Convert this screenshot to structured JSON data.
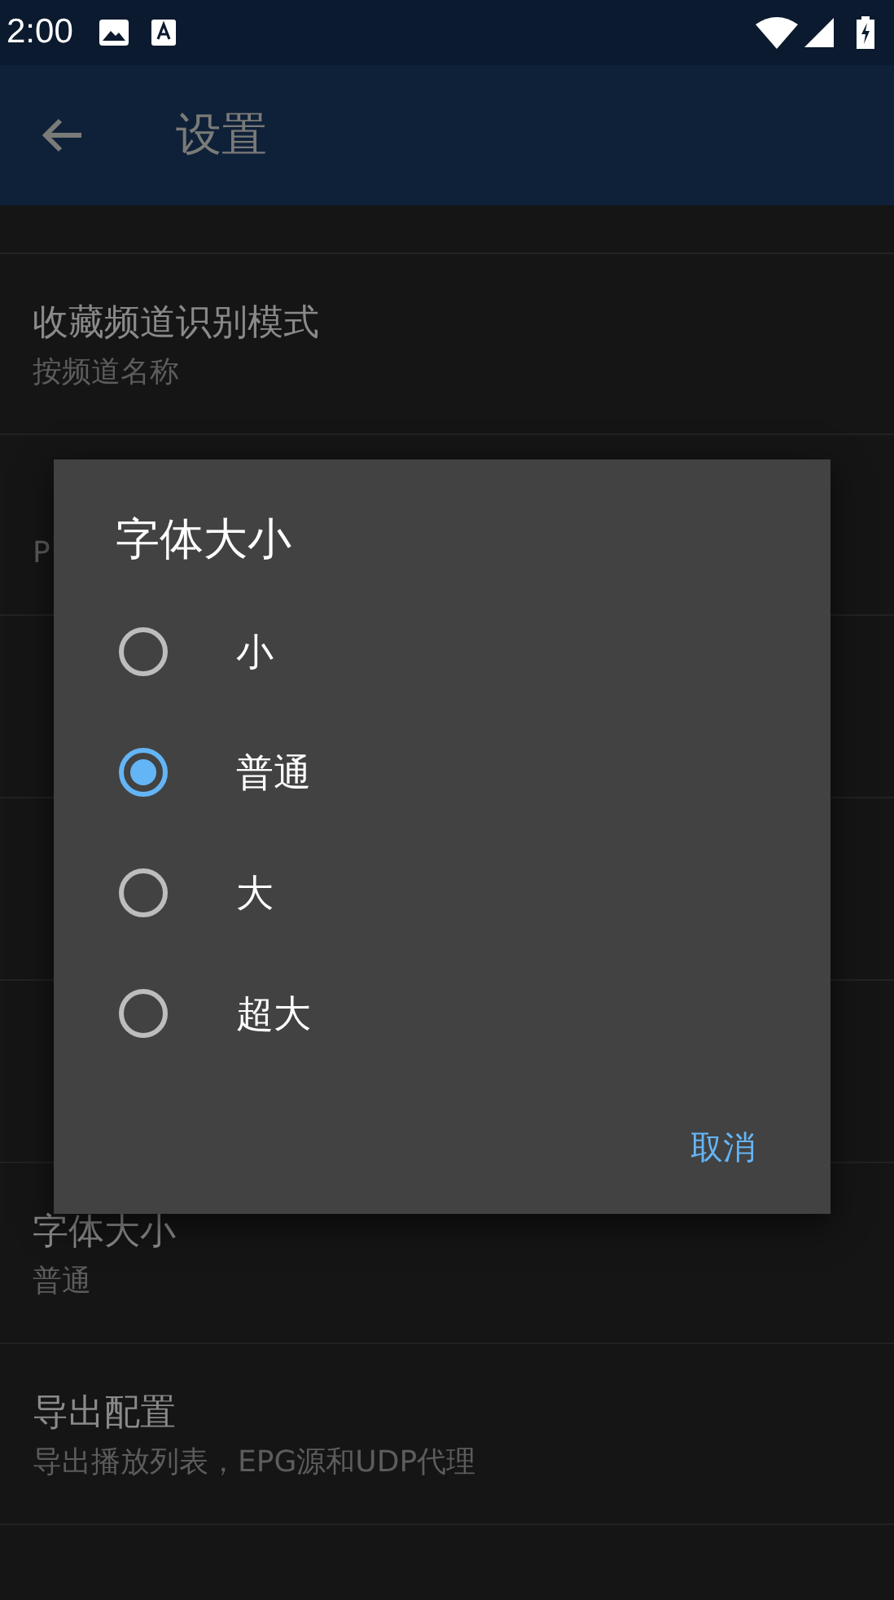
{
  "status_bar": {
    "time": "2:00"
  },
  "app_bar": {
    "title": "设置"
  },
  "settings": [
    {
      "title": "收藏频道识别模式",
      "subtitle": "按频道名称"
    },
    {
      "subtitle": "P"
    },
    {
      "title": "字体大小",
      "subtitle": "普通"
    },
    {
      "title": "导出配置",
      "subtitle": "导出播放列表，EPG源和UDP代理"
    }
  ],
  "dialog": {
    "title": "字体大小",
    "options": [
      {
        "label": "小",
        "selected": false
      },
      {
        "label": "普通",
        "selected": true
      },
      {
        "label": "大",
        "selected": false
      },
      {
        "label": "超大",
        "selected": false
      }
    ],
    "cancel": "取消"
  }
}
